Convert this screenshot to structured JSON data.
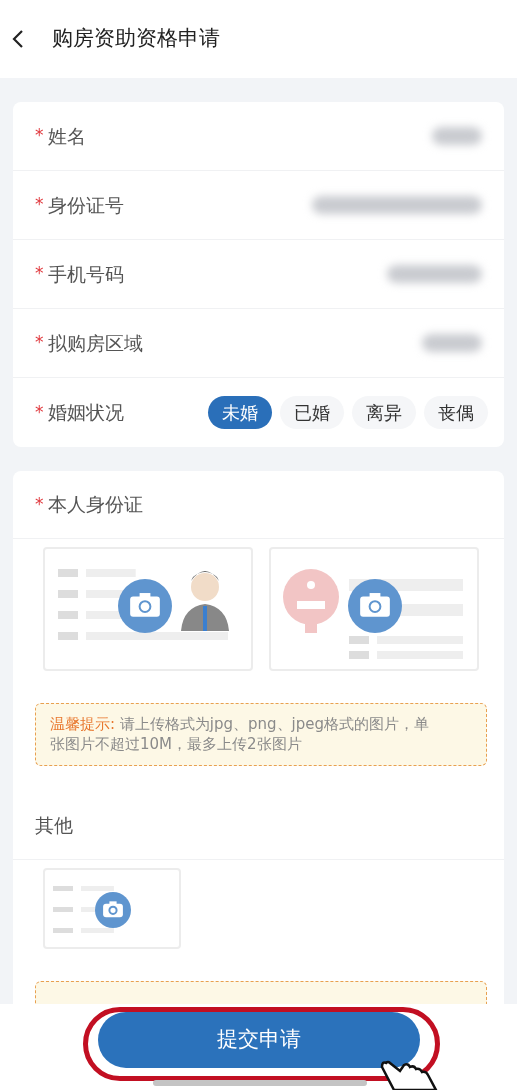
{
  "header": {
    "title": "购房资助资格申请"
  },
  "fields": [
    {
      "label": "姓名",
      "required_mark": "*",
      "value_masked": true
    },
    {
      "label": "身份证号",
      "required_mark": "*",
      "value_masked": true
    },
    {
      "label": "手机号码",
      "required_mark": "*",
      "value_masked": true
    },
    {
      "label": "拟购房区域",
      "required_mark": "*",
      "value_masked": true
    }
  ],
  "marital": {
    "label": "婚姻状况",
    "required_mark": "*",
    "options": [
      {
        "label": "未婚",
        "selected": true
      },
      {
        "label": "已婚",
        "selected": false
      },
      {
        "label": "离异",
        "selected": false
      },
      {
        "label": "丧偶",
        "selected": false
      }
    ]
  },
  "uploads": [
    {
      "title": "本人身份证",
      "required_mark": "*",
      "tiles": [
        {
          "kind": "id_front"
        },
        {
          "kind": "id_back"
        }
      ],
      "tip": {
        "label": "温馨提示:",
        "text": "请上传格式为jpg、png、jpeg格式的图片，单张图片不超过10M，最多上传2张图片"
      }
    },
    {
      "title": "其他",
      "tiles": [
        {
          "kind": "document"
        }
      ],
      "tip_cut_off": true
    }
  ],
  "submit": {
    "label": "提交申请",
    "highlight_ring": true,
    "pointer_hand": true
  }
}
